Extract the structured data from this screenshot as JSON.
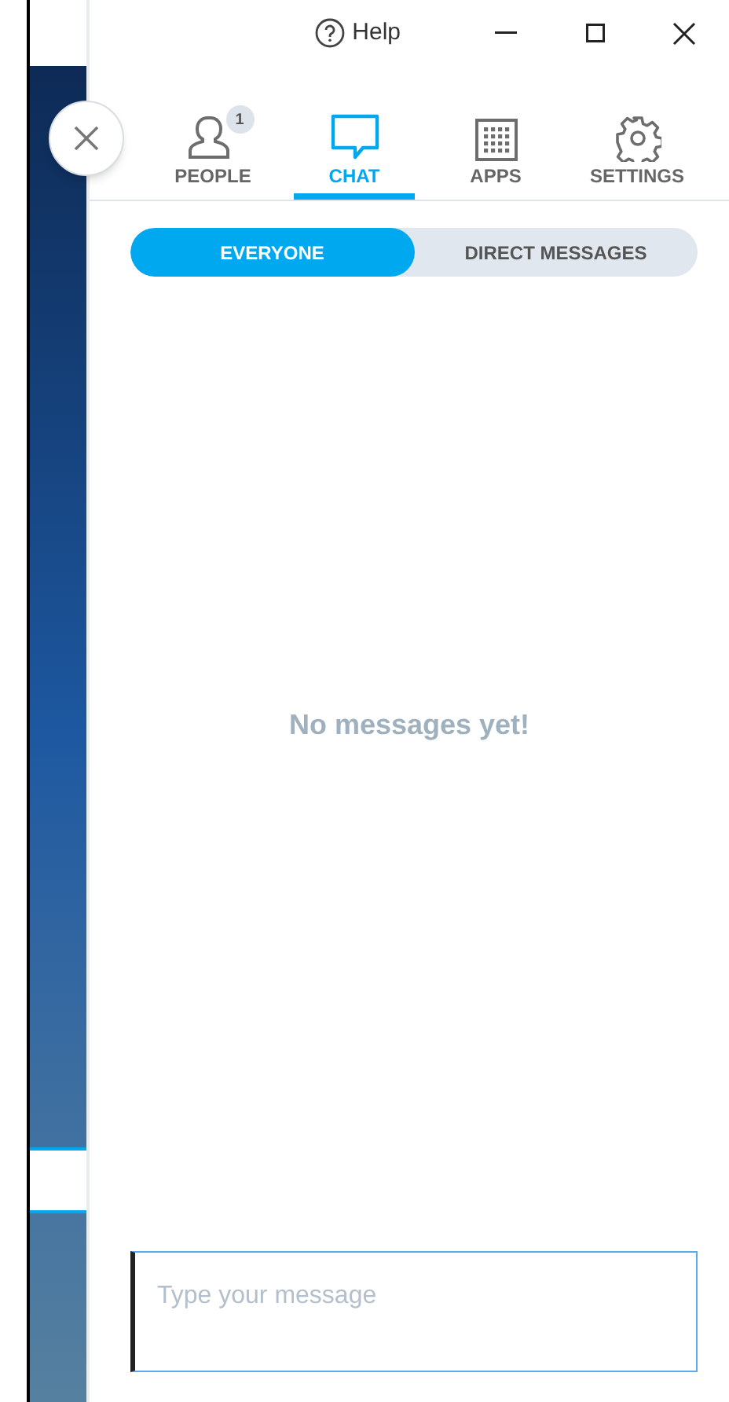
{
  "title_bar": {
    "help_label": "Help"
  },
  "tabs": [
    {
      "kind": "people",
      "label": "PEOPLE",
      "badge": "1",
      "selected": false
    },
    {
      "kind": "chat",
      "label": "CHAT",
      "selected": true
    },
    {
      "kind": "apps",
      "label": "APPS",
      "selected": false
    },
    {
      "kind": "settings",
      "label": "SETTINGS",
      "selected": false
    }
  ],
  "segments": [
    {
      "label": "EVERYONE",
      "selected": true
    },
    {
      "label": "DIRECT MESSAGES",
      "selected": false
    }
  ],
  "empty_message": "No messages yet!",
  "message_input": {
    "placeholder": "Type your message",
    "focused": true
  }
}
